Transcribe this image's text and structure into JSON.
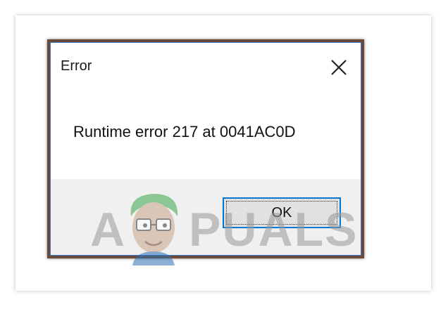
{
  "dialog": {
    "title": "Error",
    "close_icon": "close-icon",
    "message": "Runtime error 217 at 0041AC0D",
    "ok_label": "OK"
  },
  "watermark": {
    "brand": "APPUALS",
    "letter_a": "A",
    "letters_rest": "PUALS"
  },
  "colors": {
    "accent": "#0078d7",
    "frame": "#6a4a34",
    "footer": "#f0f0f0"
  }
}
